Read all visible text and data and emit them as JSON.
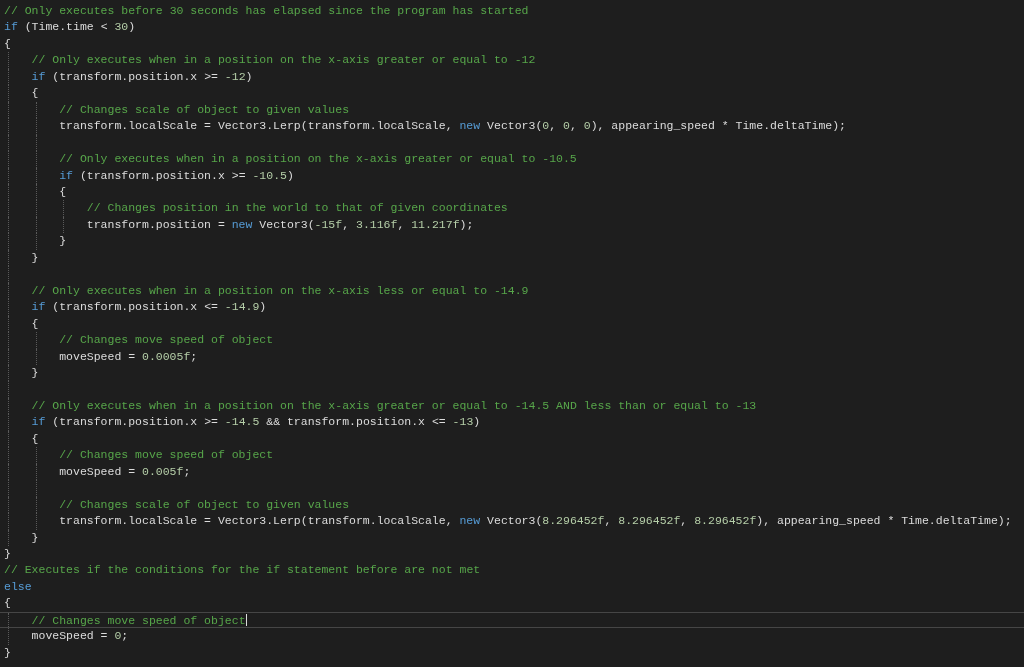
{
  "editor": {
    "lines": [
      {
        "kind": "code",
        "tokens": [
          {
            "kind": "comment",
            "text": "// Only executes before 30 seconds has elapsed since the program has started"
          }
        ]
      },
      {
        "kind": "code",
        "tokens": [
          {
            "kind": "keyword",
            "text": "if"
          },
          {
            "kind": "plain",
            "text": " (Time.time < "
          },
          {
            "kind": "number",
            "text": "30"
          },
          {
            "kind": "plain",
            "text": ")"
          }
        ]
      },
      {
        "kind": "code",
        "tokens": [
          {
            "kind": "plain",
            "text": "{"
          }
        ]
      },
      {
        "kind": "block",
        "children": [
          {
            "kind": "code",
            "tokens": [
              {
                "kind": "comment",
                "text": "// Only executes when in a position on the x-axis greater or equal to -12"
              }
            ]
          },
          {
            "kind": "code",
            "tokens": [
              {
                "kind": "keyword",
                "text": "if"
              },
              {
                "kind": "plain",
                "text": " (transform.position.x >= "
              },
              {
                "kind": "number",
                "text": "-12"
              },
              {
                "kind": "plain",
                "text": ")"
              }
            ]
          },
          {
            "kind": "code",
            "tokens": [
              {
                "kind": "plain",
                "text": "{"
              }
            ]
          },
          {
            "kind": "block",
            "children": [
              {
                "kind": "code",
                "tokens": [
                  {
                    "kind": "comment",
                    "text": "// Changes scale of object to given values"
                  }
                ]
              },
              {
                "kind": "code",
                "tokens": [
                  {
                    "kind": "plain",
                    "text": "transform.localScale = Vector3.Lerp(transform.localScale, "
                  },
                  {
                    "kind": "keyword",
                    "text": "new"
                  },
                  {
                    "kind": "plain",
                    "text": " Vector3("
                  },
                  {
                    "kind": "number",
                    "text": "0"
                  },
                  {
                    "kind": "plain",
                    "text": ", "
                  },
                  {
                    "kind": "number",
                    "text": "0"
                  },
                  {
                    "kind": "plain",
                    "text": ", "
                  },
                  {
                    "kind": "number",
                    "text": "0"
                  },
                  {
                    "kind": "plain",
                    "text": "), appearing_speed * Time.deltaTime);"
                  }
                ]
              },
              {
                "kind": "blank"
              },
              {
                "kind": "code",
                "tokens": [
                  {
                    "kind": "comment",
                    "text": "// Only executes when in a position on the x-axis greater or equal to -10.5"
                  }
                ]
              },
              {
                "kind": "code",
                "tokens": [
                  {
                    "kind": "keyword",
                    "text": "if"
                  },
                  {
                    "kind": "plain",
                    "text": " (transform.position.x >= "
                  },
                  {
                    "kind": "number",
                    "text": "-10.5"
                  },
                  {
                    "kind": "plain",
                    "text": ")"
                  }
                ]
              },
              {
                "kind": "code",
                "tokens": [
                  {
                    "kind": "plain",
                    "text": "{"
                  }
                ]
              },
              {
                "kind": "block",
                "children": [
                  {
                    "kind": "code",
                    "tokens": [
                      {
                        "kind": "comment",
                        "text": "// Changes position in the world to that of given coordinates"
                      }
                    ]
                  },
                  {
                    "kind": "code",
                    "tokens": [
                      {
                        "kind": "plain",
                        "text": "transform.position = "
                      },
                      {
                        "kind": "keyword",
                        "text": "new"
                      },
                      {
                        "kind": "plain",
                        "text": " Vector3("
                      },
                      {
                        "kind": "number",
                        "text": "-15f"
                      },
                      {
                        "kind": "plain",
                        "text": ", "
                      },
                      {
                        "kind": "number",
                        "text": "3.116f"
                      },
                      {
                        "kind": "plain",
                        "text": ", "
                      },
                      {
                        "kind": "number",
                        "text": "11.217f"
                      },
                      {
                        "kind": "plain",
                        "text": ");"
                      }
                    ]
                  }
                ]
              },
              {
                "kind": "code",
                "tokens": [
                  {
                    "kind": "plain",
                    "text": "}"
                  }
                ]
              }
            ]
          },
          {
            "kind": "code",
            "tokens": [
              {
                "kind": "plain",
                "text": "}"
              }
            ]
          },
          {
            "kind": "blank"
          },
          {
            "kind": "code",
            "tokens": [
              {
                "kind": "comment",
                "text": "// Only executes when in a position on the x-axis less or equal to -14.9"
              }
            ]
          },
          {
            "kind": "code",
            "tokens": [
              {
                "kind": "keyword",
                "text": "if"
              },
              {
                "kind": "plain",
                "text": " (transform.position.x <= "
              },
              {
                "kind": "number",
                "text": "-14.9"
              },
              {
                "kind": "plain",
                "text": ")"
              }
            ]
          },
          {
            "kind": "code",
            "tokens": [
              {
                "kind": "plain",
                "text": "{"
              }
            ]
          },
          {
            "kind": "block",
            "children": [
              {
                "kind": "code",
                "tokens": [
                  {
                    "kind": "comment",
                    "text": "// Changes move speed of object"
                  }
                ]
              },
              {
                "kind": "code",
                "tokens": [
                  {
                    "kind": "plain",
                    "text": "moveSpeed = "
                  },
                  {
                    "kind": "number",
                    "text": "0.0005f"
                  },
                  {
                    "kind": "plain",
                    "text": ";"
                  }
                ]
              }
            ]
          },
          {
            "kind": "code",
            "tokens": [
              {
                "kind": "plain",
                "text": "}"
              }
            ]
          },
          {
            "kind": "blank"
          },
          {
            "kind": "code",
            "tokens": [
              {
                "kind": "comment",
                "text": "// Only executes when in a position on the x-axis greater or equal to -14.5 AND less than or equal to -13"
              }
            ]
          },
          {
            "kind": "code",
            "tokens": [
              {
                "kind": "keyword",
                "text": "if"
              },
              {
                "kind": "plain",
                "text": " (transform.position.x >= "
              },
              {
                "kind": "number",
                "text": "-14.5"
              },
              {
                "kind": "plain",
                "text": " && transform.position.x <= "
              },
              {
                "kind": "number",
                "text": "-13"
              },
              {
                "kind": "plain",
                "text": ")"
              }
            ]
          },
          {
            "kind": "code",
            "tokens": [
              {
                "kind": "plain",
                "text": "{"
              }
            ]
          },
          {
            "kind": "block",
            "children": [
              {
                "kind": "code",
                "tokens": [
                  {
                    "kind": "comment",
                    "text": "// Changes move speed of object"
                  }
                ]
              },
              {
                "kind": "code",
                "tokens": [
                  {
                    "kind": "plain",
                    "text": "moveSpeed = "
                  },
                  {
                    "kind": "number",
                    "text": "0.005f"
                  },
                  {
                    "kind": "plain",
                    "text": ";"
                  }
                ]
              },
              {
                "kind": "blank"
              },
              {
                "kind": "code",
                "tokens": [
                  {
                    "kind": "comment",
                    "text": "// Changes scale of object to given values"
                  }
                ]
              },
              {
                "kind": "code",
                "tokens": [
                  {
                    "kind": "plain",
                    "text": "transform.localScale = Vector3.Lerp(transform.localScale, "
                  },
                  {
                    "kind": "keyword",
                    "text": "new"
                  },
                  {
                    "kind": "plain",
                    "text": " Vector3("
                  },
                  {
                    "kind": "number",
                    "text": "8.296452f"
                  },
                  {
                    "kind": "plain",
                    "text": ", "
                  },
                  {
                    "kind": "number",
                    "text": "8.296452f"
                  },
                  {
                    "kind": "plain",
                    "text": ", "
                  },
                  {
                    "kind": "number",
                    "text": "8.296452f"
                  },
                  {
                    "kind": "plain",
                    "text": "), appearing_speed * Time.deltaTime);"
                  }
                ]
              }
            ]
          },
          {
            "kind": "code",
            "tokens": [
              {
                "kind": "plain",
                "text": "}"
              }
            ]
          }
        ]
      },
      {
        "kind": "code",
        "tokens": [
          {
            "kind": "plain",
            "text": "}"
          }
        ]
      },
      {
        "kind": "code",
        "tokens": [
          {
            "kind": "comment",
            "text": "// Executes if the conditions for the if statement before are not met"
          }
        ]
      },
      {
        "kind": "code",
        "tokens": [
          {
            "kind": "keyword",
            "text": "else"
          }
        ]
      },
      {
        "kind": "code",
        "tokens": [
          {
            "kind": "plain",
            "text": "{"
          }
        ]
      },
      {
        "kind": "block",
        "children": [
          {
            "kind": "code",
            "current": true,
            "tokens": [
              {
                "kind": "comment",
                "text": "// Changes move speed of object"
              }
            ]
          },
          {
            "kind": "code",
            "current": false,
            "tokens": [
              {
                "kind": "plain",
                "text": "moveSpeed = "
              },
              {
                "kind": "number",
                "text": "0"
              },
              {
                "kind": "plain",
                "text": ";"
              }
            ]
          }
        ]
      },
      {
        "kind": "code",
        "tokens": [
          {
            "kind": "plain",
            "text": "}"
          }
        ]
      }
    ]
  }
}
